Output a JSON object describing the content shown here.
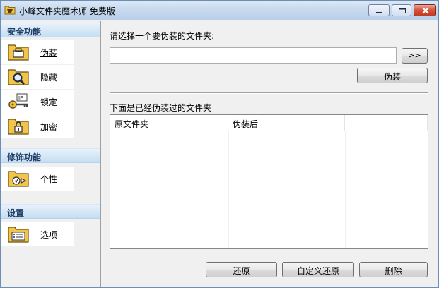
{
  "window": {
    "title": "小峰文件夹魔术师 免费版",
    "icon": "folder-magic-app-icon",
    "controls": {
      "minimize_icon": "minimize-icon",
      "maximize_icon": "maximize-icon",
      "close_icon": "close-icon"
    }
  },
  "sidebar": {
    "sections": [
      {
        "title": "安全功能",
        "items": [
          {
            "label": "伪装",
            "icon": "folder-disguise-icon",
            "active": true
          },
          {
            "label": "隐藏",
            "icon": "folder-search-icon",
            "active": false
          },
          {
            "label": "锁定",
            "icon": "key-icon",
            "active": false
          },
          {
            "label": "加密",
            "icon": "folder-lock-icon",
            "active": false
          }
        ]
      },
      {
        "title": "修饰功能",
        "items": [
          {
            "label": "个性",
            "icon": "folder-personalize-icon",
            "active": false
          }
        ]
      },
      {
        "title": "设置",
        "items": [
          {
            "label": "选项",
            "icon": "folder-options-icon",
            "active": false
          }
        ]
      }
    ]
  },
  "main": {
    "prompt_label": "请选择一个要伪装的文件夹:",
    "path_input": {
      "value": "",
      "placeholder": ""
    },
    "browse_button": ">>",
    "disguise_button": "伪装",
    "list_label": "下面是已经伪装过的文件夹",
    "table": {
      "columns": [
        "原文件夹",
        "伪装后",
        ""
      ],
      "rows": []
    },
    "actions": {
      "restore": "还原",
      "custom_restore": "自定义还原",
      "delete": "删除"
    }
  },
  "colors": {
    "section_header_text": "#1f3f66",
    "folder_icon": "#f2c44a",
    "close_button": "#c43a22"
  }
}
